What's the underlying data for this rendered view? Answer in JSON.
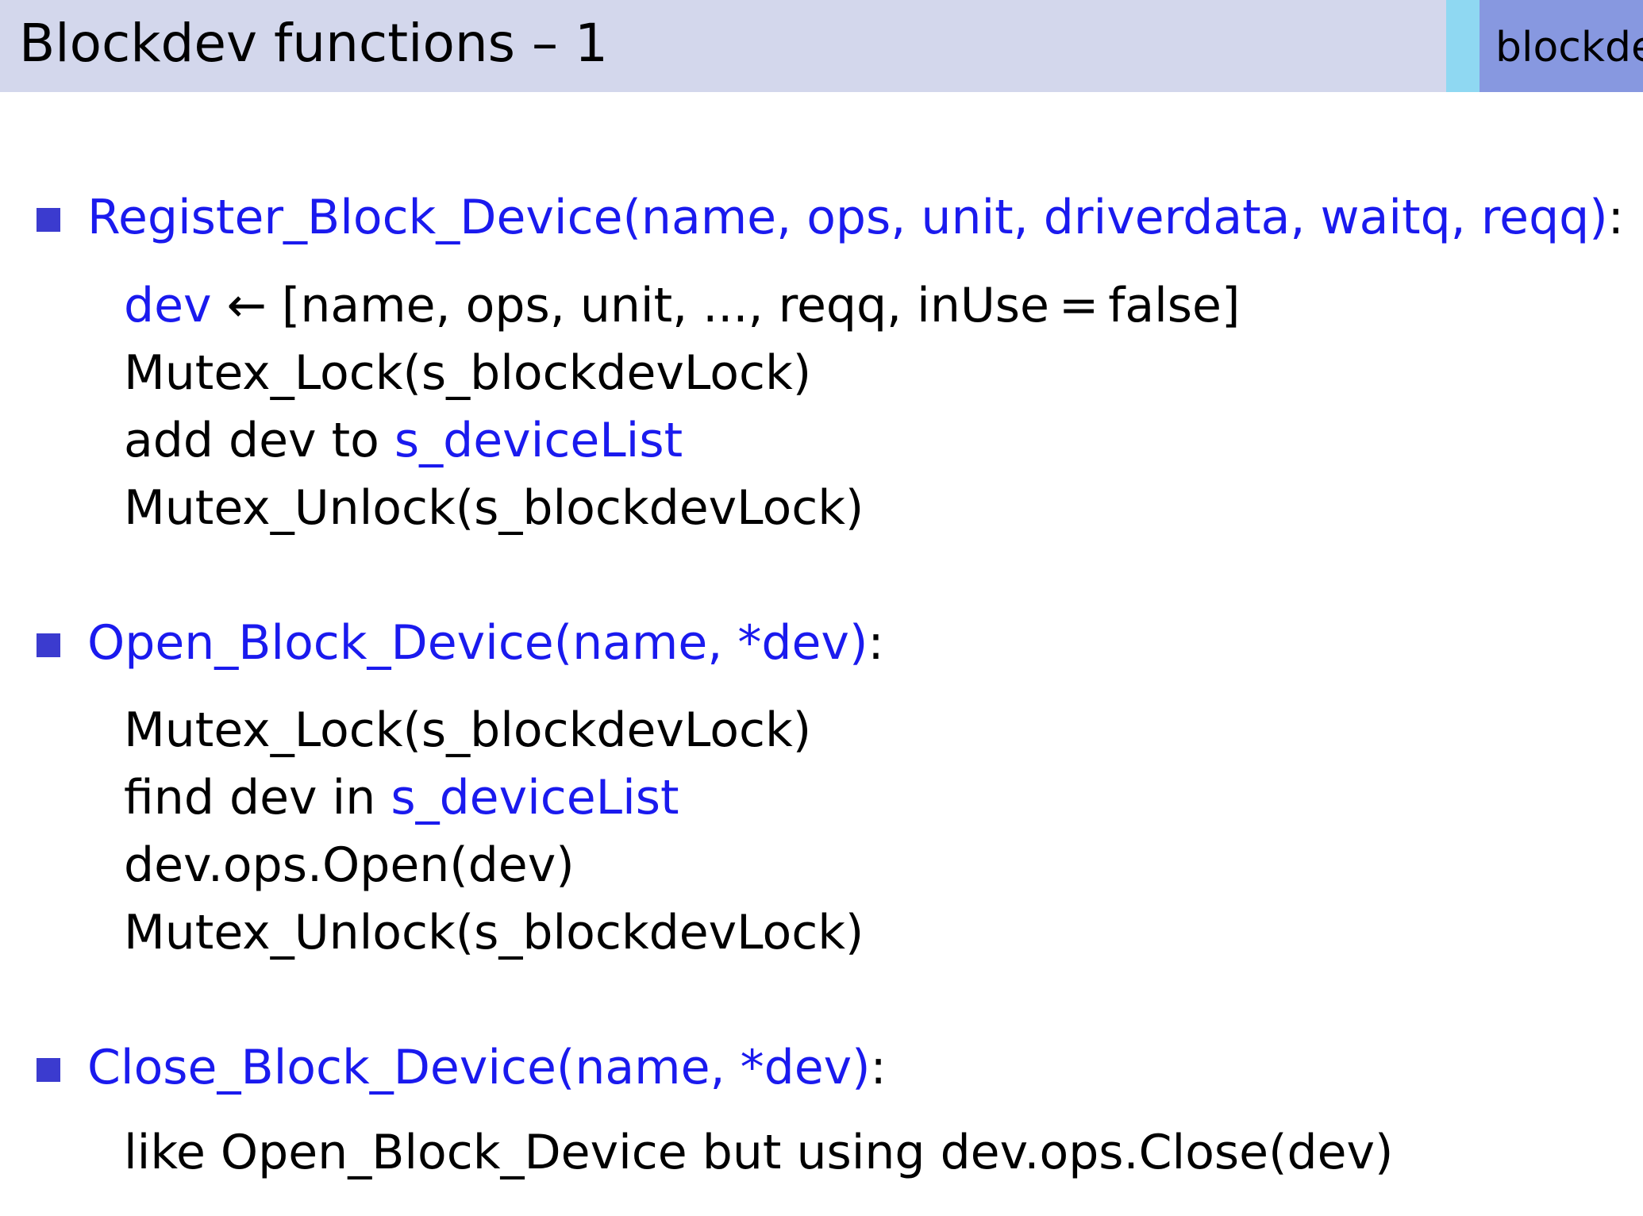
{
  "header": {
    "title": "Blockdev functions – 1",
    "section_tab": "blockde"
  },
  "items": [
    {
      "heading_call": "Register_Block_Device(name, ops, unit, driverdata, waitq, reqq)",
      "heading_suffix": ":",
      "lines": [
        {
          "pre": "",
          "hl": "dev",
          "post": " ← [name, ops, unit, ..., reqq, inUse = false]"
        },
        {
          "pre": "Mutex_Lock(s_blockdevLock)",
          "hl": "",
          "post": ""
        },
        {
          "pre": "add dev to ",
          "hl": "s_deviceList",
          "post": ""
        },
        {
          "pre": "Mutex_Unlock(s_blockdevLock)",
          "hl": "",
          "post": ""
        }
      ]
    },
    {
      "heading_call": "Open_Block_Device(name, *dev)",
      "heading_suffix": ":",
      "lines": [
        {
          "pre": "Mutex_Lock(s_blockdevLock)",
          "hl": "",
          "post": ""
        },
        {
          "pre": "find dev in ",
          "hl": "s_deviceList",
          "post": ""
        },
        {
          "pre": "dev.ops.Open(dev)",
          "hl": "",
          "post": ""
        },
        {
          "pre": "Mutex_Unlock(s_blockdevLock)",
          "hl": "",
          "post": ""
        }
      ]
    },
    {
      "heading_call": "Close_Block_Device(name, *dev)",
      "heading_suffix": ":",
      "lines": [
        {
          "pre": "like Open_Block_Device but using dev.ops.Close(dev)",
          "hl": "",
          "post": ""
        }
      ]
    }
  ],
  "colors": {
    "header_bg": "#d3d7ec",
    "header_strip": "#8fd8f2",
    "header_tab": "#8798e0",
    "bullet": "#3b3bcf",
    "highlight_text": "#1a1aee"
  },
  "icons": {
    "bullet": "square-bullet-icon"
  }
}
